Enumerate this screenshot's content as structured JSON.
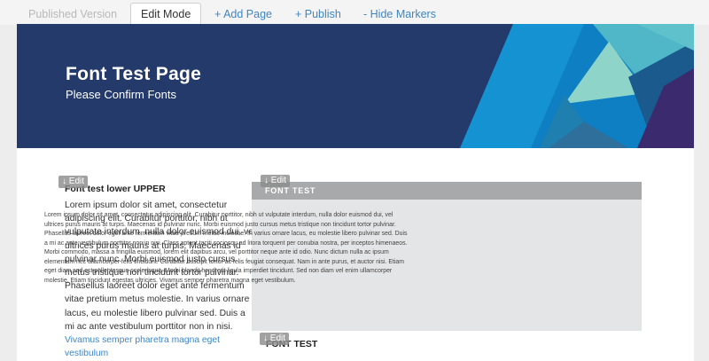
{
  "tabs": {
    "published": "Published Version",
    "edit_mode": "Edit Mode",
    "add_page": "+ Add Page",
    "publish": "+ Publish",
    "hide_markers": "- Hide Markers"
  },
  "hero": {
    "title": "Font Test Page",
    "subtitle": "Please Confirm Fonts"
  },
  "edit_label": "↓ Edit",
  "left_column": {
    "heading": "Font test lower UPPER",
    "body": "Lorem ipsum dolor sit amet, consectetur adipiscing elit. Curabitur porttitor, nibh ut vulputate interdum, nulla dolor euismod dui, vel ultrices purus mauris at turpis. Maecenas id pulvinar nunc. Morbi euismod justo cursus metus tristique non tincidunt tortor pulvinar. Phasellus laoreet dolor eget ante fermentum vitae pretium metus molestie. In varius ornare lacus, eu molestie libero pulvinar sed. Duis a mi ac ante vestibulum porttitor non in nisi.",
    "link_text": "Vivamus semper pharetra magna eget vestibulum"
  },
  "box": {
    "header": "FONT TEST",
    "body": "Lorem ipsum dolor sit amet, consectetur adipiscing elit. Curabitur porttitor, nibh ut vulputate interdum, nulla dolor euismod dui, vel ultrices purus mauris at turpis. Maecenas id pulvinar nunc. Morbi euismod justo cursus metus tristique non tincidunt tortor pulvinar. Phasellus laoreet dolor eget ante fermentum vitae pretium metus molestie. In varius ornare lacus, eu molestie libero pulvinar sed. Duis a mi ac ante vestibulum porttitor non in nisi. Class aptent taciti sociosqu ad litora torquent per conubia nostra, per inceptos himenaeos. Morbi commodo, massa a fringilla euismod, lorem elit dapibus arcu, vel porttitor neque ante id odio. Nunc dictum nulla ac ipsum elementum nec ullamcorper felis tincidunt. Curabitur suscipit tortor ac felis feugiat consequat. Nam in ante purus, et auctor nisi. Etiam eget diam sed est pellentesque scelerisque. Morbi blandit hendrerit ligula imperdiet tincidunt. Sed non diam vel enim ullamcorper molestie. Etiam tincidunt egestas ultricies. Vivamus semper pharetra magna eget vestibulum."
  },
  "bottom_heading": "FONT TEST",
  "colors": {
    "hero_bg": "#233a6b",
    "link": "#3f86c4",
    "box_bg": "#e4e5e6",
    "box_header": "#a8a9ab"
  }
}
